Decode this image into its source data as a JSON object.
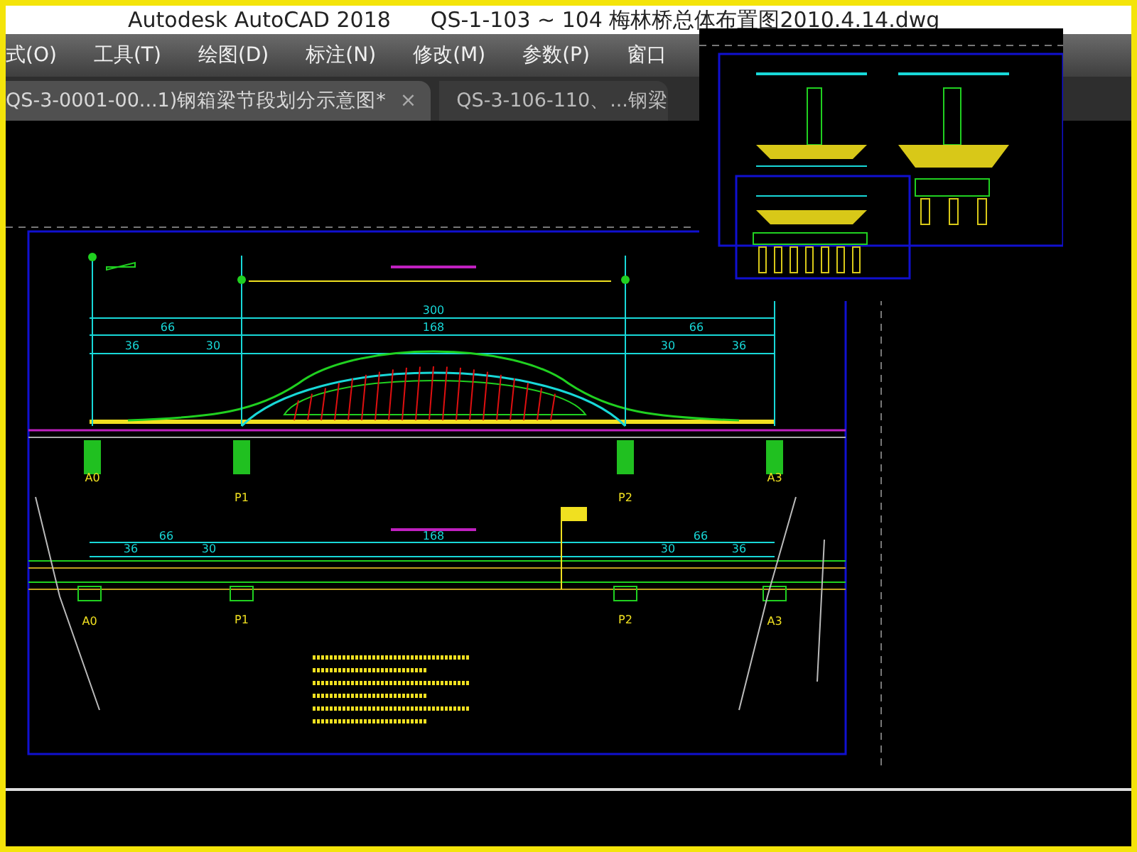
{
  "window": {
    "app_name": "Autodesk AutoCAD 2018",
    "file_name": "QS-1-103 ~ 104 梅林桥总体布置图2010.4.14.dwg"
  },
  "menu": [
    "式(O)",
    "工具(T)",
    "绘图(D)",
    "标注(N)",
    "修改(M)",
    "参数(P)",
    "窗口"
  ],
  "tabs": [
    {
      "label": "QS-3-0001-00...1)钢箱梁节段划分示意图*",
      "selected": true,
      "close": "×"
    },
    {
      "label": "QS-3-106-110、...钢梁",
      "selected": false
    }
  ],
  "drawing": {
    "elevation_piers": [
      "A0",
      "P1",
      "P2",
      "A3"
    ],
    "elevation_dims": [
      "300",
      "66",
      "168",
      "66",
      "36",
      "30",
      "30",
      "36"
    ],
    "plan_piers": [
      "A0",
      "P1",
      "P2",
      "A3"
    ],
    "plan_dims": [
      "66",
      "168",
      "66",
      "36",
      "30",
      "30",
      "36"
    ]
  }
}
